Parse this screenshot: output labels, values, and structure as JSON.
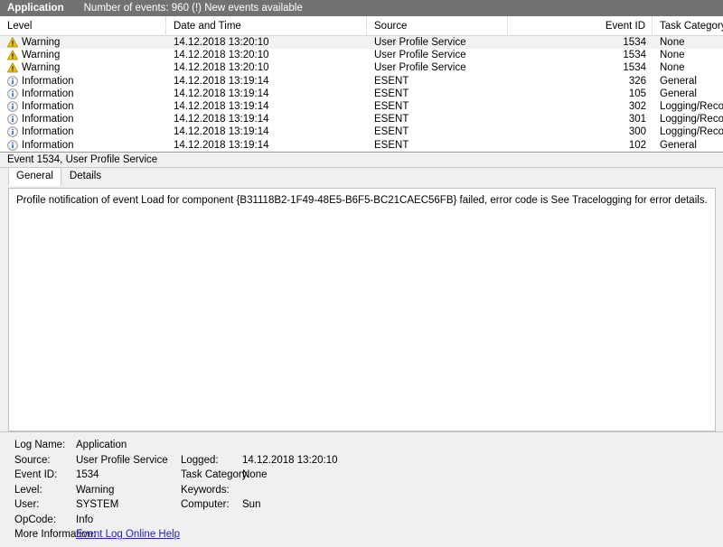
{
  "log_header": {
    "log_name": "Application",
    "status": "Number of events: 960 (!) New events available"
  },
  "event_list": {
    "columns": {
      "level": "Level",
      "datetime": "Date and Time",
      "source": "Source",
      "event_id": "Event ID",
      "task_category": "Task Category"
    },
    "rows": [
      {
        "level": "Warning",
        "icon": "warning-icon",
        "datetime": "14.12.2018 13:20:10",
        "source": "User Profile Service",
        "event_id": "1534",
        "task_category": "None",
        "selected": true
      },
      {
        "level": "Warning",
        "icon": "warning-icon",
        "datetime": "14.12.2018 13:20:10",
        "source": "User Profile Service",
        "event_id": "1534",
        "task_category": "None",
        "selected": false
      },
      {
        "level": "Warning",
        "icon": "warning-icon",
        "datetime": "14.12.2018 13:20:10",
        "source": "User Profile Service",
        "event_id": "1534",
        "task_category": "None",
        "selected": false
      },
      {
        "level": "Information",
        "icon": "information-icon",
        "datetime": "14.12.2018 13:19:14",
        "source": "ESENT",
        "event_id": "326",
        "task_category": "General",
        "selected": false
      },
      {
        "level": "Information",
        "icon": "information-icon",
        "datetime": "14.12.2018 13:19:14",
        "source": "ESENT",
        "event_id": "105",
        "task_category": "General",
        "selected": false
      },
      {
        "level": "Information",
        "icon": "information-icon",
        "datetime": "14.12.2018 13:19:14",
        "source": "ESENT",
        "event_id": "302",
        "task_category": "Logging/Recovery",
        "selected": false
      },
      {
        "level": "Information",
        "icon": "information-icon",
        "datetime": "14.12.2018 13:19:14",
        "source": "ESENT",
        "event_id": "301",
        "task_category": "Logging/Recovery",
        "selected": false
      },
      {
        "level": "Information",
        "icon": "information-icon",
        "datetime": "14.12.2018 13:19:14",
        "source": "ESENT",
        "event_id": "300",
        "task_category": "Logging/Recovery",
        "selected": false
      },
      {
        "level": "Information",
        "icon": "information-icon",
        "datetime": "14.12.2018 13:19:14",
        "source": "ESENT",
        "event_id": "102",
        "task_category": "General",
        "selected": false
      }
    ]
  },
  "detail": {
    "title": "Event 1534, User Profile Service",
    "tabs": [
      {
        "label": "General",
        "active": true
      },
      {
        "label": "Details",
        "active": false
      }
    ],
    "description": "Profile notification of event Load for component {B31118B2-1F49-48E5-B6F5-BC21CAEC56FB} failed, error code is See Tracelogging for error details."
  },
  "meta": {
    "log_name_label": "Log Name:",
    "log_name_value": "Application",
    "source_label": "Source:",
    "source_value": "User Profile Service",
    "logged_label": "Logged:",
    "logged_value": "14.12.2018 13:20:10",
    "event_id_label": "Event ID:",
    "event_id_value": "1534",
    "task_category_label": "Task Category:",
    "task_category_value": "None",
    "level_label": "Level:",
    "level_value": "Warning",
    "keywords_label": "Keywords:",
    "keywords_value": "",
    "user_label": "User:",
    "user_value": "SYSTEM",
    "computer_label": "Computer:",
    "computer_value": "Sun",
    "opcode_label": "OpCode:",
    "opcode_value": "Info",
    "more_info_label": "More Information:",
    "more_info_link": "Event Log Online Help"
  },
  "colors": {
    "header_bar": "#727272",
    "warning": "#f2c200",
    "information": "#1a5fb4",
    "link": "#2222cc",
    "selected_row": "#f2f2f2"
  }
}
